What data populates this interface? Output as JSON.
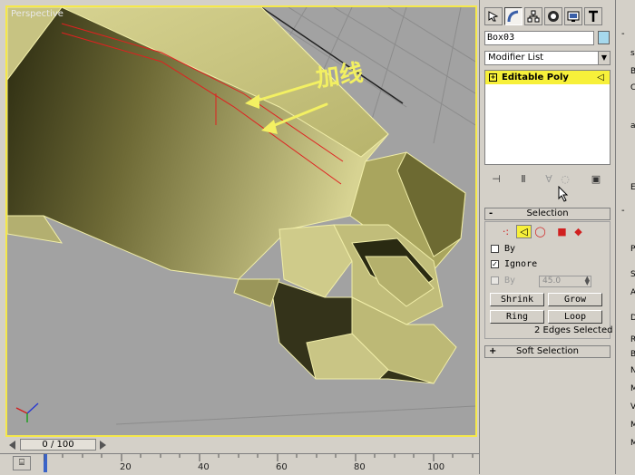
{
  "viewport": {
    "label": "Perspective",
    "annotation": "加线",
    "colors": {
      "border": "#f5e84a",
      "background": "#a2a2a2",
      "model": "#c9c583",
      "edge": "#e02020",
      "arrow": "#f3f062"
    }
  },
  "timeslider": {
    "position": "0 / 100"
  },
  "ruler": {
    "ticks": [
      "20",
      "40",
      "60",
      "80",
      "100"
    ],
    "first": "0"
  },
  "panel": {
    "tabs": [
      "create-icon",
      "modify-icon",
      "hierarchy-icon",
      "motion-icon",
      "display-icon",
      "utilities-icon"
    ],
    "object_name": "Box03",
    "object_color": "#a6d8ec",
    "modifier_list": "Modifier List",
    "stack_item": "Editable Poly",
    "selection": {
      "header": "Selection",
      "by_vertex": "By",
      "ignore_backfacing": "Ignore",
      "by_angle": "By",
      "angle_value": "45.0",
      "shrink": "Shrink",
      "grow": "Grow",
      "ring": "Ring",
      "loop": "Loop",
      "status": "2 Edges Selected"
    },
    "soft_selection": {
      "header": "Soft Selection"
    }
  },
  "right_strip": [
    "ss",
    "B",
    "C",
    "a",
    "E",
    "P",
    "S",
    "A",
    "D",
    "R",
    "B",
    "N",
    "M",
    "V",
    "M",
    "M"
  ]
}
